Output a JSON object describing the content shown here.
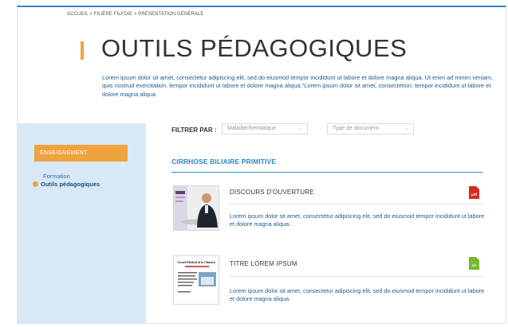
{
  "breadcrumb": "ACCUEIL > FILIÈRE FILFOIE > PRÉSENTATION GÉNÉRALE",
  "page_title": "OUTILS PÉDAGOGIQUES",
  "intro": "Lorem ipsum dolor sit amet, consectetur adipiscing elit, sed do eiusmod tempor incididunt ut labore et dolore magna aliqua. Ut enim ad minim veniam, quis nostrud exercitation. tempor incididunt ut labore et dolore magna aliqua.\"Lorem ipsum dolor sit amet, consectetion. tempor incididunt ut labore et dolore magna aliqua.",
  "sidebar": {
    "active_section": "ENSEIGNEMENT",
    "items": [
      {
        "label": "Formation",
        "current": false
      },
      {
        "label": "Outils pédagogiques",
        "current": true
      }
    ]
  },
  "filters": {
    "label": "FILTRER PAR :",
    "theme": "Maladie/thématique",
    "doc_type": "Type de document"
  },
  "section": {
    "title": "CIRRHOSE BILIAIRE PRIMITIVE"
  },
  "documents": [
    {
      "title": "DISCOURS D'OUVERTURE",
      "file_type": "pdf",
      "description": "Lorem ipsum dolor sit amet, consectetur adipiscing elit, sed do eiusmod tempor incididunt ut labore et dolore magna aliqua."
    },
    {
      "title": "TITRE LOREM IPSUM",
      "file_type": "xls",
      "description": "Lorem ipsum dolor sit amet, consectetur adipiscing elit, sed do eiusmod tempor incididunt ut labore et dolore magna aliqua.",
      "thumb_heading": "Accueil Médical de la Clinicien"
    }
  ],
  "colors": {
    "accent": "#f0a23c",
    "link": "#2f86c8",
    "sidebar_bg": "#d9e8f6",
    "pdf": "#d62a1f",
    "xls": "#76b82a"
  }
}
